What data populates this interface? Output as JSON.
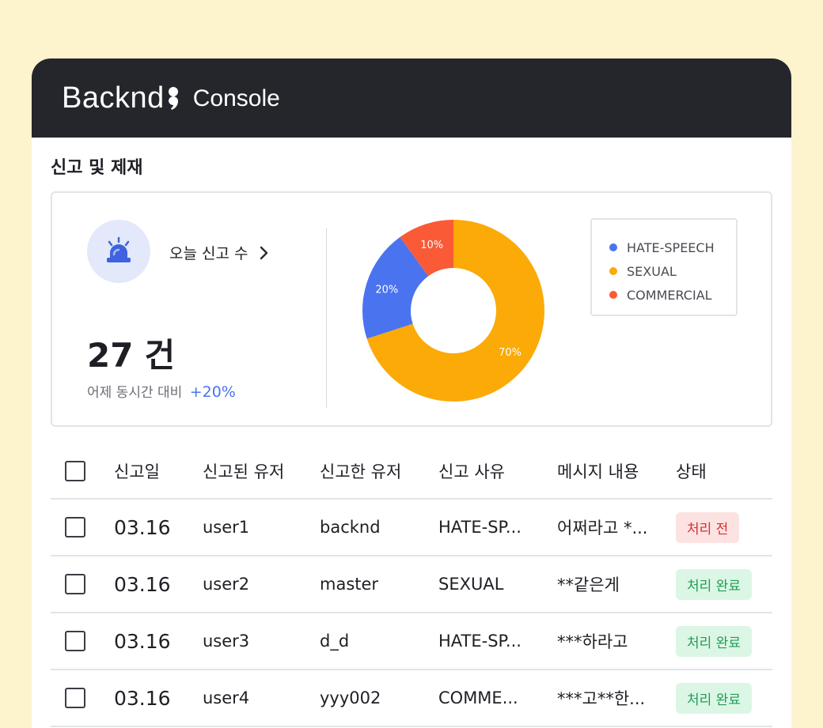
{
  "app": {
    "logo_text": "Backnd",
    "console_label": "Console"
  },
  "page": {
    "title": "신고 및 제재"
  },
  "summary": {
    "today_link_label": "오늘 신고 수",
    "count_value": "27",
    "count_unit": "건",
    "compare_label": "어제 동시간 대비",
    "compare_delta": "+20%",
    "icon": "alarm-siren-icon",
    "accent_color": "#4a73f0"
  },
  "chart_data": {
    "type": "pie",
    "donut": true,
    "categories": [
      "HATE-SPEECH",
      "SEXUAL",
      "COMMERCIAL"
    ],
    "values": [
      20,
      70,
      10
    ],
    "labels": [
      "20%",
      "70%",
      "10%"
    ],
    "colors": [
      "#4a73f0",
      "#fbaa08",
      "#fa5a36"
    ],
    "legend_position": "right"
  },
  "table": {
    "headers": {
      "date": "신고일",
      "reported_user": "신고된 유저",
      "reporter": "신고한 유저",
      "reason": "신고 사유",
      "message": "메시지 내용",
      "status": "상태"
    },
    "rows": [
      {
        "date": "03.16",
        "reported_user": "user1",
        "reporter": "backnd",
        "reason": "HATE-SP...",
        "message": "어쩌라고 *...",
        "status": "처리 전",
        "status_type": "pending"
      },
      {
        "date": "03.16",
        "reported_user": "user2",
        "reporter": "master",
        "reason": "SEXUAL",
        "message": "**같은게",
        "status": "처리 완료",
        "status_type": "done"
      },
      {
        "date": "03.16",
        "reported_user": "user3",
        "reporter": "d_d",
        "reason": "HATE-SP...",
        "message": "***하라고",
        "status": "처리 완료",
        "status_type": "done"
      },
      {
        "date": "03.16",
        "reported_user": "user4",
        "reporter": "yyy002",
        "reason": "COMME...",
        "message": "***고**한...",
        "status": "처리 완료",
        "status_type": "done"
      }
    ]
  }
}
